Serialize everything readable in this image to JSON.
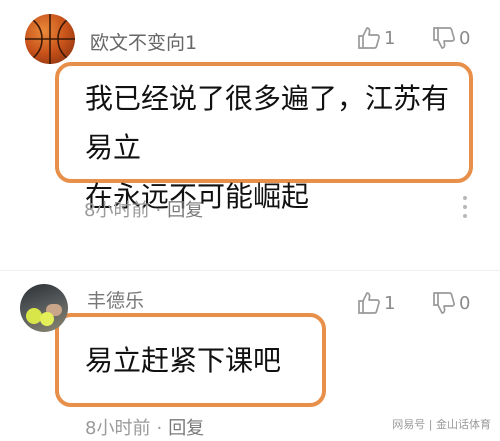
{
  "comments": [
    {
      "username": "欧文不变向1",
      "likes": "1",
      "dislikes": "0",
      "text_line1": "我已经说了很多遍了，江苏有易立",
      "text_line2": "在永远不可能崛起",
      "time": "8小时前",
      "separator": "·",
      "reply": "回复"
    },
    {
      "username": "丰德乐",
      "likes": "1",
      "dislikes": "0",
      "text_line1": "易立赶紧下课吧",
      "time": "8小时前",
      "separator": "·",
      "reply": "回复"
    }
  ],
  "watermark": "网易号 | 金山话体育",
  "colors": {
    "highlight_border": "#e8904a",
    "meta_text": "#9a9a9a",
    "icon_stroke": "#9a9a9a"
  },
  "icons": [
    "thumbs-up-icon",
    "thumbs-down-icon",
    "more-vertical-icon"
  ]
}
